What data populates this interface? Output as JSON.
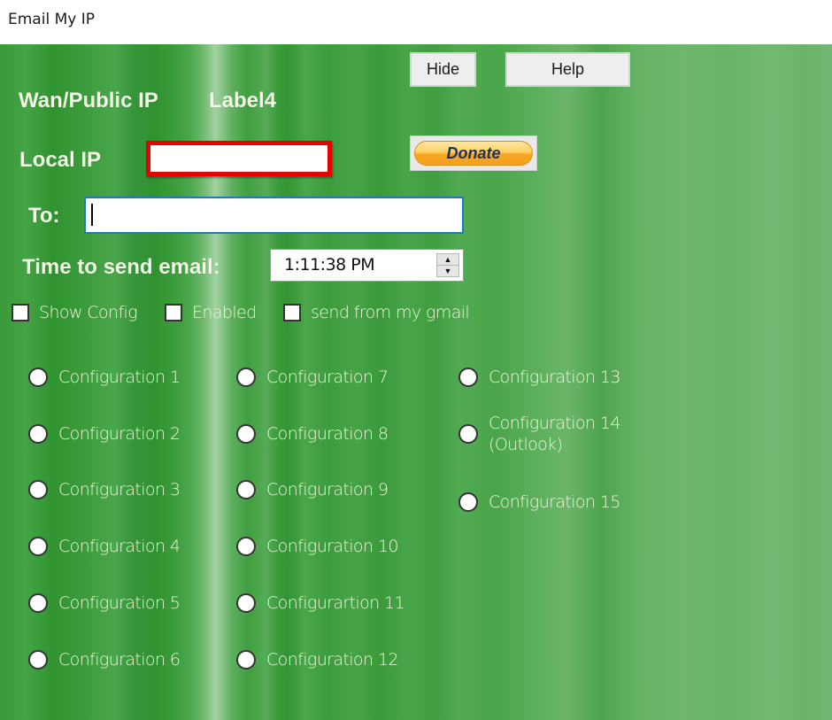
{
  "window": {
    "title": "Email My IP"
  },
  "header": {
    "wan_label": "Wan/Public IP",
    "wan_value": "Label4",
    "local_ip_label": "Local IP",
    "local_ip_value": ""
  },
  "buttons": {
    "hide": "Hide",
    "help": "Help",
    "donate": "Donate"
  },
  "to": {
    "label": "To:",
    "value": "",
    "placeholder": ""
  },
  "time": {
    "label": "Time to send email:",
    "value": "1:11:38 PM",
    "up_icon": "▲",
    "down_icon": "▼"
  },
  "checkboxes": [
    {
      "label": "Show Config",
      "checked": false
    },
    {
      "label": "Enabled",
      "checked": false
    },
    {
      "label": "send from my gmail",
      "checked": false
    }
  ],
  "configurations": [
    {
      "label": "Configuration 1",
      "selected": false
    },
    {
      "label": "Configuration 2",
      "selected": false
    },
    {
      "label": "Configuration 3",
      "selected": false
    },
    {
      "label": "Configuration 4",
      "selected": false
    },
    {
      "label": "Configuration 5",
      "selected": false
    },
    {
      "label": "Configuration 6",
      "selected": false
    },
    {
      "label": "Configuration 7",
      "selected": false
    },
    {
      "label": "Configuration 8",
      "selected": false
    },
    {
      "label": "Configuration 9",
      "selected": false
    },
    {
      "label": "Configuration 10",
      "selected": false
    },
    {
      "label": "Configurartion 11",
      "selected": false
    },
    {
      "label": "Configuration 12",
      "selected": false
    },
    {
      "label": "Configuration 13",
      "selected": false
    },
    {
      "label": "Configuration 14",
      "label_line2": "(Outlook)",
      "selected": false
    },
    {
      "label": "Configuration 15",
      "selected": false
    }
  ],
  "colors": {
    "background_green": "#3a9a3a",
    "label_text": "#f2f7e6",
    "local_ip_border": "#e60000",
    "to_input_border": "#1c78c8",
    "donate_orange": "#f6a623"
  }
}
